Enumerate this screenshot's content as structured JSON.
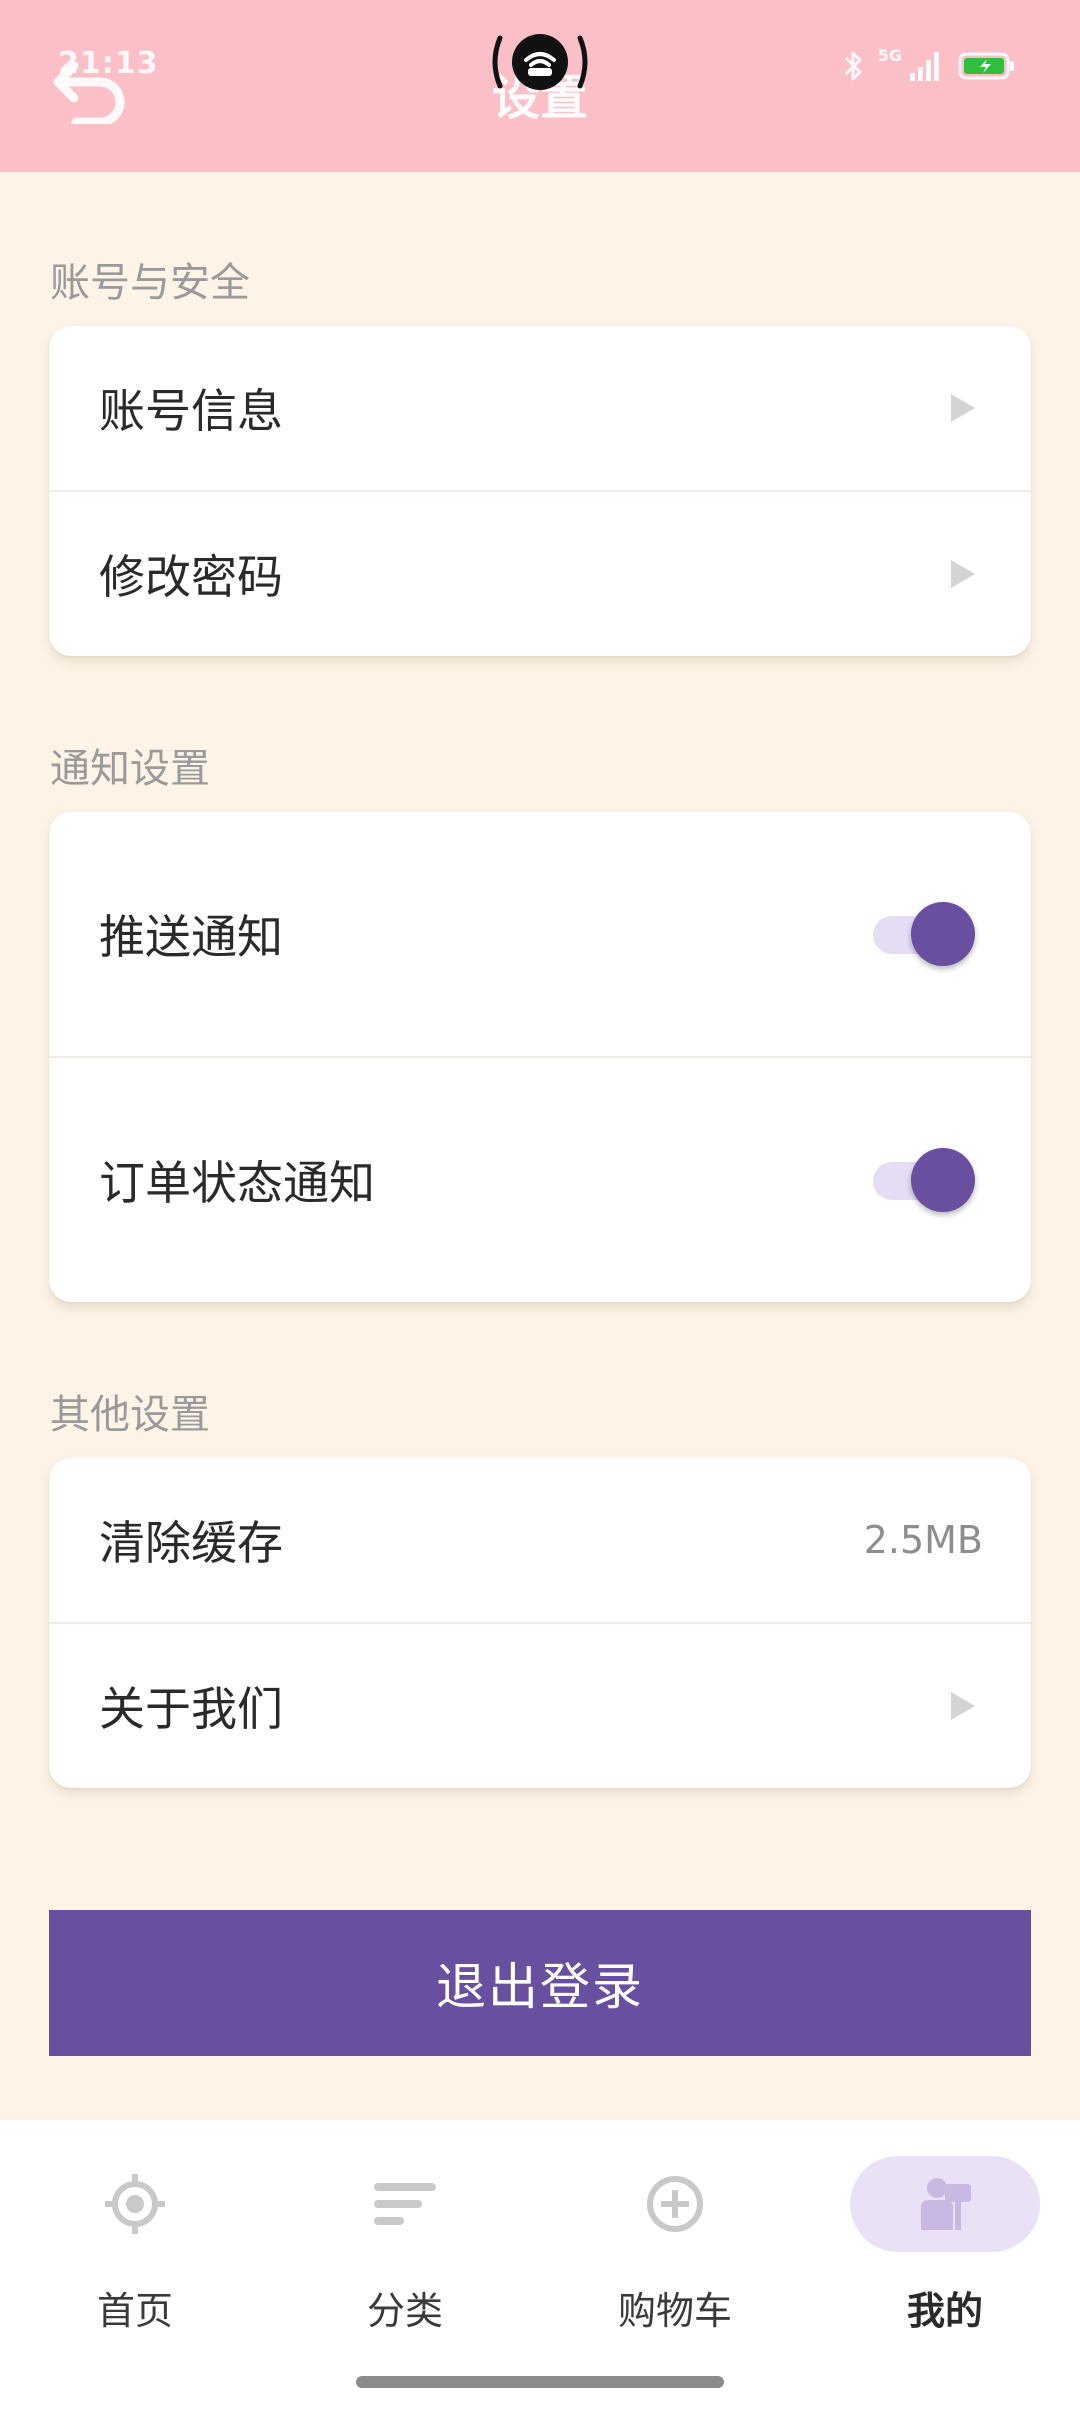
{
  "status_bar": {
    "time": "21:13",
    "network_label": "5G"
  },
  "header": {
    "title": "设置",
    "back_icon": "back-arrow-icon"
  },
  "sections": {
    "account": {
      "title": "账号与安全",
      "items": [
        {
          "label": "账号信息",
          "icon": "chevron-right-icon"
        },
        {
          "label": "修改密码",
          "icon": "chevron-right-icon"
        }
      ]
    },
    "notifications": {
      "title": "通知设置",
      "items": [
        {
          "label": "推送通知",
          "enabled": true
        },
        {
          "label": "订单状态通知",
          "enabled": true
        }
      ]
    },
    "other": {
      "title": "其他设置",
      "items": [
        {
          "label": "清除缓存",
          "value": "2.5MB"
        },
        {
          "label": "关于我们",
          "icon": "chevron-right-icon"
        }
      ]
    }
  },
  "logout": {
    "label": "退出登录"
  },
  "bottom_nav": {
    "items": [
      {
        "label": "首页",
        "icon": "home-compass-icon",
        "active": false
      },
      {
        "label": "分类",
        "icon": "category-lines-icon",
        "active": false
      },
      {
        "label": "购物车",
        "icon": "cart-plus-icon",
        "active": false
      },
      {
        "label": "我的",
        "icon": "profile-icon",
        "active": true
      }
    ]
  },
  "colors": {
    "header_bg": "#fbbfc8",
    "page_bg": "#fdf3e6",
    "accent": "#684f9f",
    "toggle_track": "#e6dcf4",
    "nav_active_bg": "#ebe1f6"
  }
}
